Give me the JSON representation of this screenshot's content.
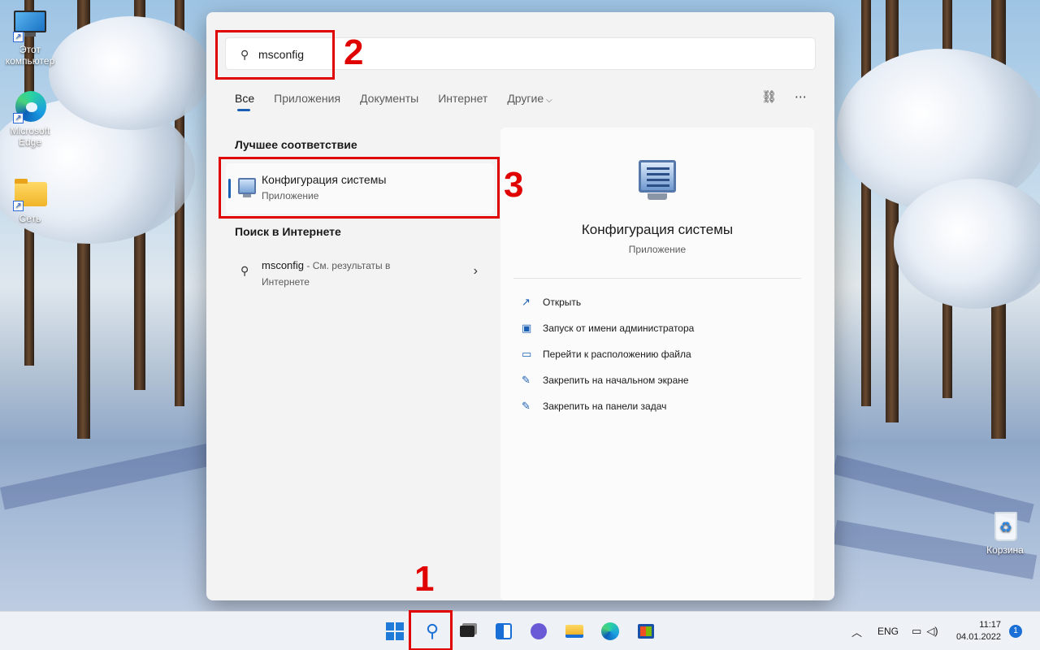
{
  "desktop": {
    "icons": [
      {
        "label": "Этот компьютер",
        "icon": "monitor-icon"
      },
      {
        "label": "Microsoft Edge",
        "icon": "edge-icon"
      },
      {
        "label": "Сеть",
        "icon": "network-folder-icon"
      },
      {
        "label": "Корзина",
        "icon": "recycle-bin-icon"
      }
    ]
  },
  "search": {
    "query": "msconfig",
    "tabs": [
      "Все",
      "Приложения",
      "Документы",
      "Интернет",
      "Другие"
    ],
    "active_tab": "Все",
    "best_match_heading": "Лучшее соответствие",
    "best_match": {
      "title": "Конфигурация системы",
      "subtitle": "Приложение"
    },
    "web_heading": "Поиск в Интернете",
    "web_result": {
      "term": "msconfig",
      "suffix": " - См. результаты в",
      "line2": "Интернете"
    }
  },
  "detail": {
    "title": "Конфигурация системы",
    "subtitle": "Приложение",
    "actions": [
      {
        "label": "Открыть",
        "icon": "open-external-icon"
      },
      {
        "label": "Запуск от имени администратора",
        "icon": "admin-shield-icon"
      },
      {
        "label": "Перейти к расположению файла",
        "icon": "folder-icon"
      },
      {
        "label": "Закрепить на начальном экране",
        "icon": "pin-icon"
      },
      {
        "label": "Закрепить на панели задач",
        "icon": "pin-icon"
      }
    ]
  },
  "annotations": [
    "1",
    "2",
    "3"
  ],
  "taskbar": {
    "tray_language": "ENG",
    "time": "11:17",
    "date": "04.01.2022",
    "notification_count": "1"
  },
  "colors": {
    "accent": "#1a5fb4",
    "annotation_red": "#e00000"
  }
}
